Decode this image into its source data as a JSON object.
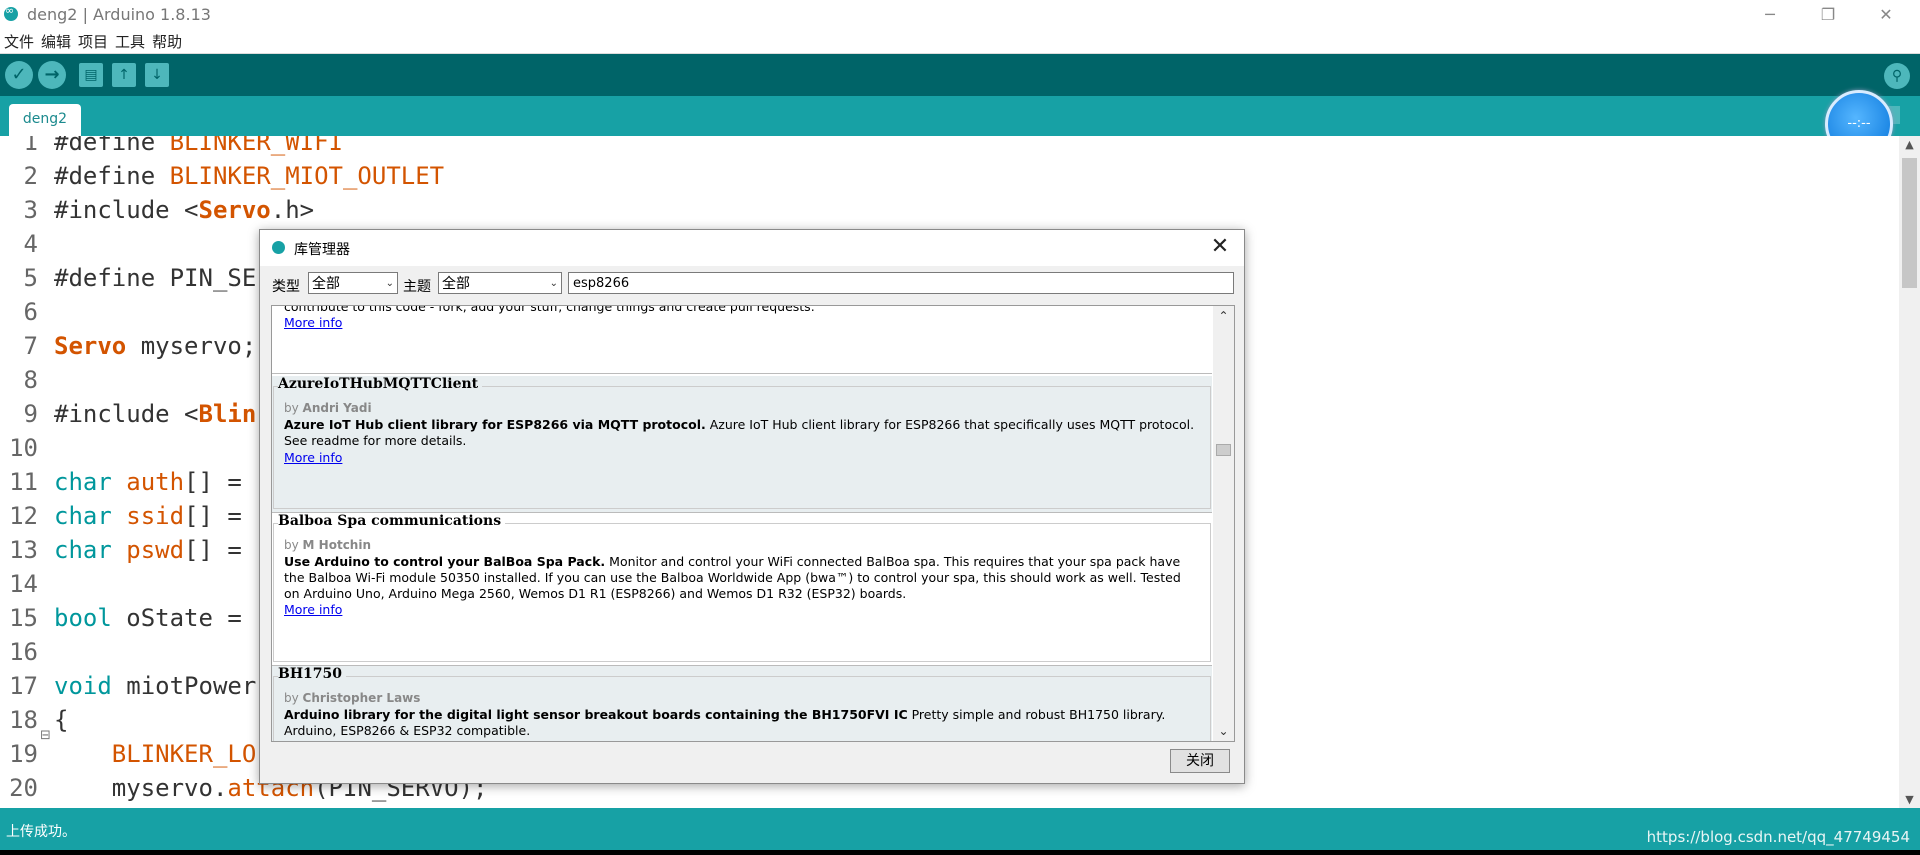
{
  "window": {
    "title": "deng2 | Arduino 1.8.13",
    "controls": [
      "─",
      "❐",
      "✕"
    ]
  },
  "menu": [
    "文件",
    "编辑",
    "项目",
    "工具",
    "帮助"
  ],
  "toolbar": {
    "verify": "✓",
    "upload": "→",
    "new": "▤",
    "open": "↑",
    "save": "↓",
    "serial": "⚲"
  },
  "tab": {
    "label": "deng2"
  },
  "badge": {
    "text": "--:--"
  },
  "editor": {
    "line_numbers": [
      "1",
      "2",
      "3",
      "4",
      "5",
      "6",
      "7",
      "8",
      "9",
      "10",
      "11",
      "12",
      "13",
      "14",
      "15",
      "16",
      "17",
      "18",
      "19",
      "20"
    ],
    "lines": [
      [
        {
          "t": "#define ",
          "c": "dark"
        },
        {
          "t": "BLINKER_WIFI",
          "c": "org"
        }
      ],
      [
        {
          "t": "#define ",
          "c": "dark"
        },
        {
          "t": "BLINKER_MIOT_OUTLET",
          "c": "org"
        }
      ],
      [
        {
          "t": "#include <",
          "c": "dark"
        },
        {
          "t": "Servo",
          "c": "bold"
        },
        {
          "t": ".h>",
          "c": "dark"
        }
      ],
      [],
      [
        {
          "t": "#define PIN_SE",
          "c": "dark"
        }
      ],
      [],
      [
        {
          "t": "Servo",
          "c": "bold"
        },
        {
          "t": " myservo;",
          "c": "dark"
        }
      ],
      [],
      [
        {
          "t": "#include <",
          "c": "dark"
        },
        {
          "t": "Blin",
          "c": "bold"
        }
      ],
      [],
      [
        {
          "t": "char",
          "c": "kw"
        },
        {
          "t": " auth",
          "c": "org"
        },
        {
          "t": "[] =",
          "c": "dark"
        }
      ],
      [
        {
          "t": "char",
          "c": "kw"
        },
        {
          "t": " ssid",
          "c": "org"
        },
        {
          "t": "[] =",
          "c": "dark"
        }
      ],
      [
        {
          "t": "char",
          "c": "kw"
        },
        {
          "t": " pswd",
          "c": "org"
        },
        {
          "t": "[] =",
          "c": "dark"
        }
      ],
      [],
      [
        {
          "t": "bool",
          "c": "kw"
        },
        {
          "t": " oState =",
          "c": "dark"
        }
      ],
      [],
      [
        {
          "t": "void",
          "c": "kw"
        },
        {
          "t": " miotPower",
          "c": "dark"
        }
      ],
      [
        {
          "t": "{",
          "c": "dark"
        }
      ],
      [
        {
          "t": "    BLINKER_LO",
          "c": "org"
        }
      ],
      [
        {
          "t": "    myservo.",
          "c": "dark"
        },
        {
          "t": "attach",
          "c": "org"
        },
        {
          "t": "(PIN_SERVO);",
          "c": "dark"
        }
      ]
    ],
    "fold_marker": "⊟"
  },
  "status": {
    "message": "上传成功。",
    "watermark": "https://blog.csdn.net/qq_47749454"
  },
  "library_manager": {
    "title": "库管理器",
    "filter": {
      "type_label": "类型",
      "type_value": "全部",
      "topic_label": "主题",
      "topic_value": "全部",
      "search_value": "esp8266"
    },
    "entries": [
      {
        "name": "",
        "author_prefix": "",
        "author": "",
        "desc_bold": "",
        "desc": "contribute to this code - fork, add your stuff, change things and create pull requests.",
        "more": "More info"
      },
      {
        "name": "AzureIoTHubMQTTClient",
        "author_prefix": "by ",
        "author": "Andri Yadi",
        "desc_bold": "Azure IoT Hub client library for ESP8266 via MQTT protocol.",
        "desc": " Azure IoT Hub client library for ESP8266 that specifically uses MQTT protocol. See readme for more details.",
        "more": "More info"
      },
      {
        "name": "Balboa Spa communications",
        "author_prefix": "by ",
        "author": "M Hotchin",
        "desc_bold": "Use Arduino to control your BalBoa Spa Pack.",
        "desc": " Monitor and control your WiFi connected BalBoa spa. This requires that your spa pack have the Balboa Wi-Fi module 50350 installed. If you can use the Balboa Worldwide App (bwa™) to control your spa, this should work as well. Tested on Arduino Uno, Arduino Mega 2560, Wemos D1 R1 (ESP8266) and Wemos D1 R32 (ESP32) boards.",
        "more": "More info"
      },
      {
        "name": "BH1750",
        "author_prefix": "by ",
        "author": "Christopher Laws",
        "desc_bold": "Arduino library for the digital light sensor breakout boards containing the BH1750FVI IC",
        "desc": " Pretty simple and robust BH1750 library. Arduino, ESP8266 & ESP32 compatible.",
        "more": ""
      }
    ],
    "close_label": "关闭"
  }
}
